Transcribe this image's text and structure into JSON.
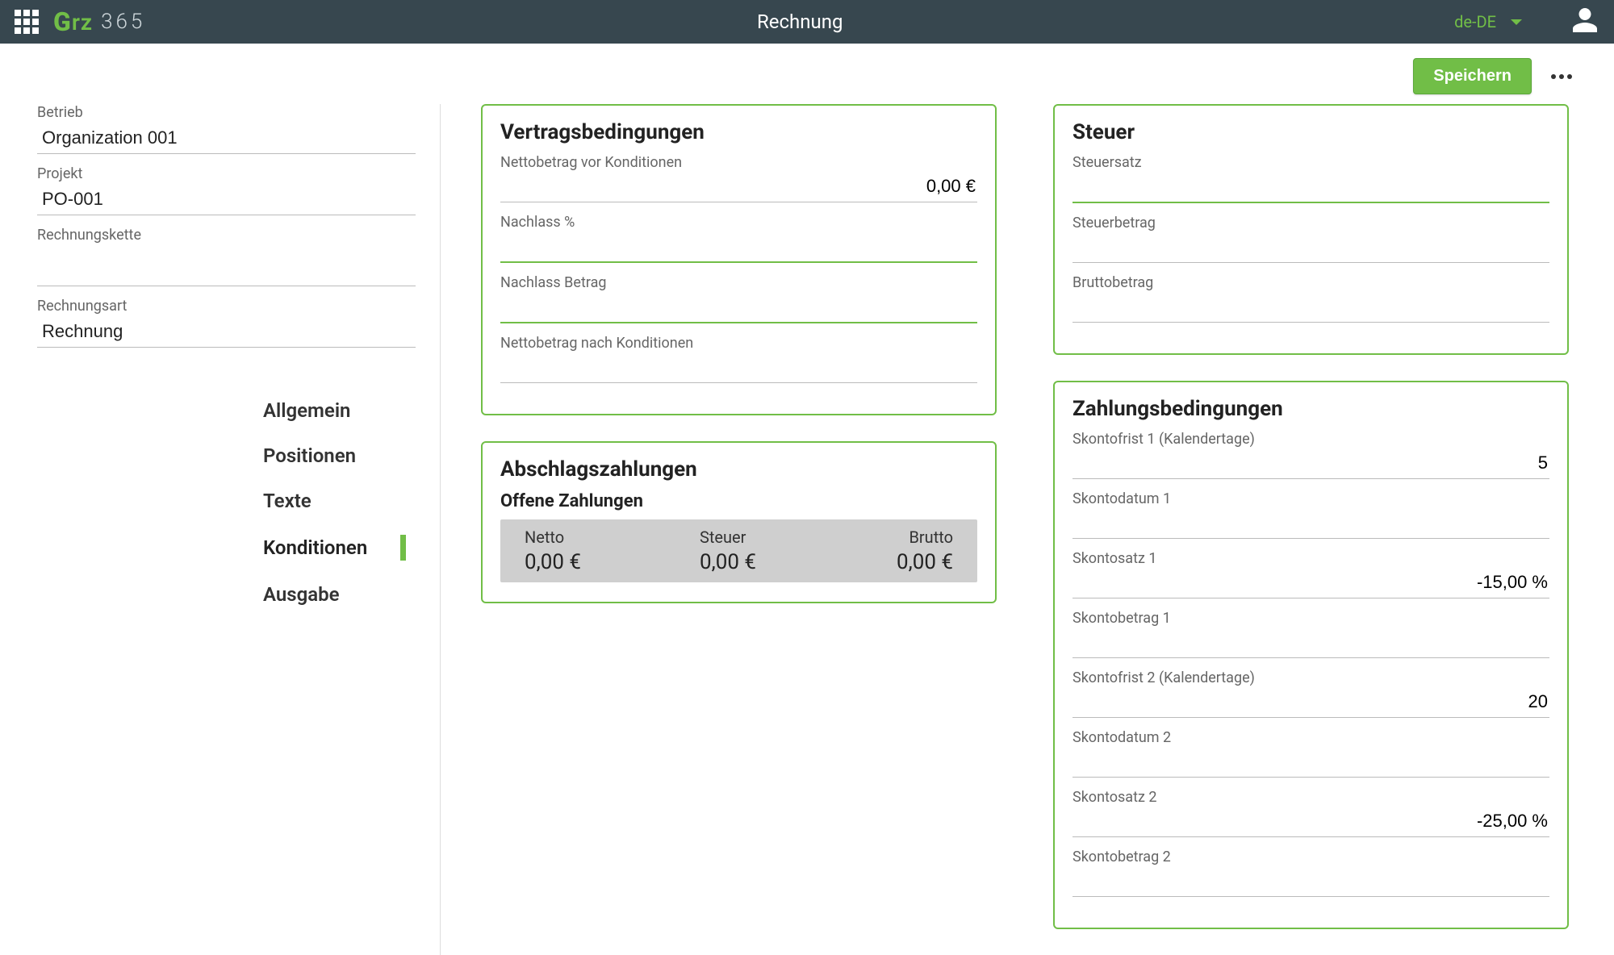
{
  "header": {
    "title": "Rechnung",
    "language": "de-DE",
    "save_label": "Speichern",
    "logo_g": "G",
    "logo_rz": "rz",
    "logo_365": "365"
  },
  "left_fields": {
    "betrieb_label": "Betrieb",
    "betrieb_value": "Organization 001",
    "projekt_label": "Projekt",
    "projekt_value": "PO-001",
    "kette_label": "Rechnungskette",
    "kette_value": "",
    "art_label": "Rechnungsart",
    "art_value": "Rechnung"
  },
  "nav": {
    "items": [
      {
        "label": "Allgemein"
      },
      {
        "label": "Positionen"
      },
      {
        "label": "Texte"
      },
      {
        "label": "Konditionen",
        "active": true
      },
      {
        "label": "Ausgabe"
      }
    ]
  },
  "cards": {
    "vertrag": {
      "title": "Vertragsbedingungen",
      "fields": [
        {
          "label": "Nettobetrag vor Konditionen",
          "value": "0,00 €",
          "style": "grey"
        },
        {
          "label": "Nachlass %",
          "value": "",
          "style": "green"
        },
        {
          "label": "Nachlass Betrag",
          "value": "",
          "style": "green"
        },
        {
          "label": "Nettobetrag nach Konditionen",
          "value": "",
          "style": "grey"
        }
      ]
    },
    "abschlag": {
      "title": "Abschlagszahlungen",
      "sub": "Offene Zahlungen",
      "cols": [
        {
          "label": "Netto",
          "value": "0,00 €"
        },
        {
          "label": "Steuer",
          "value": "0,00 €"
        },
        {
          "label": "Brutto",
          "value": "0,00 €"
        }
      ]
    },
    "steuer": {
      "title": "Steuer",
      "fields": [
        {
          "label": "Steuersatz",
          "value": "",
          "style": "green"
        },
        {
          "label": "Steuerbetrag",
          "value": "",
          "style": "grey"
        },
        {
          "label": "Bruttobetrag",
          "value": "",
          "style": "grey"
        }
      ]
    },
    "zahlung": {
      "title": "Zahlungsbedingungen",
      "fields": [
        {
          "label": "Skontofrist 1 (Kalendertage)",
          "value": "5",
          "style": "grey"
        },
        {
          "label": "Skontodatum 1",
          "value": "",
          "style": "grey"
        },
        {
          "label": "Skontosatz 1",
          "value": "-15,00 %",
          "style": "grey"
        },
        {
          "label": "Skontobetrag 1",
          "value": "",
          "style": "grey"
        },
        {
          "label": "Skontofrist 2 (Kalendertage)",
          "value": "20",
          "style": "grey"
        },
        {
          "label": "Skontodatum 2",
          "value": "",
          "style": "grey"
        },
        {
          "label": "Skontosatz 2",
          "value": "-25,00 %",
          "style": "grey"
        },
        {
          "label": "Skontobetrag 2",
          "value": "",
          "style": "grey"
        }
      ]
    }
  }
}
